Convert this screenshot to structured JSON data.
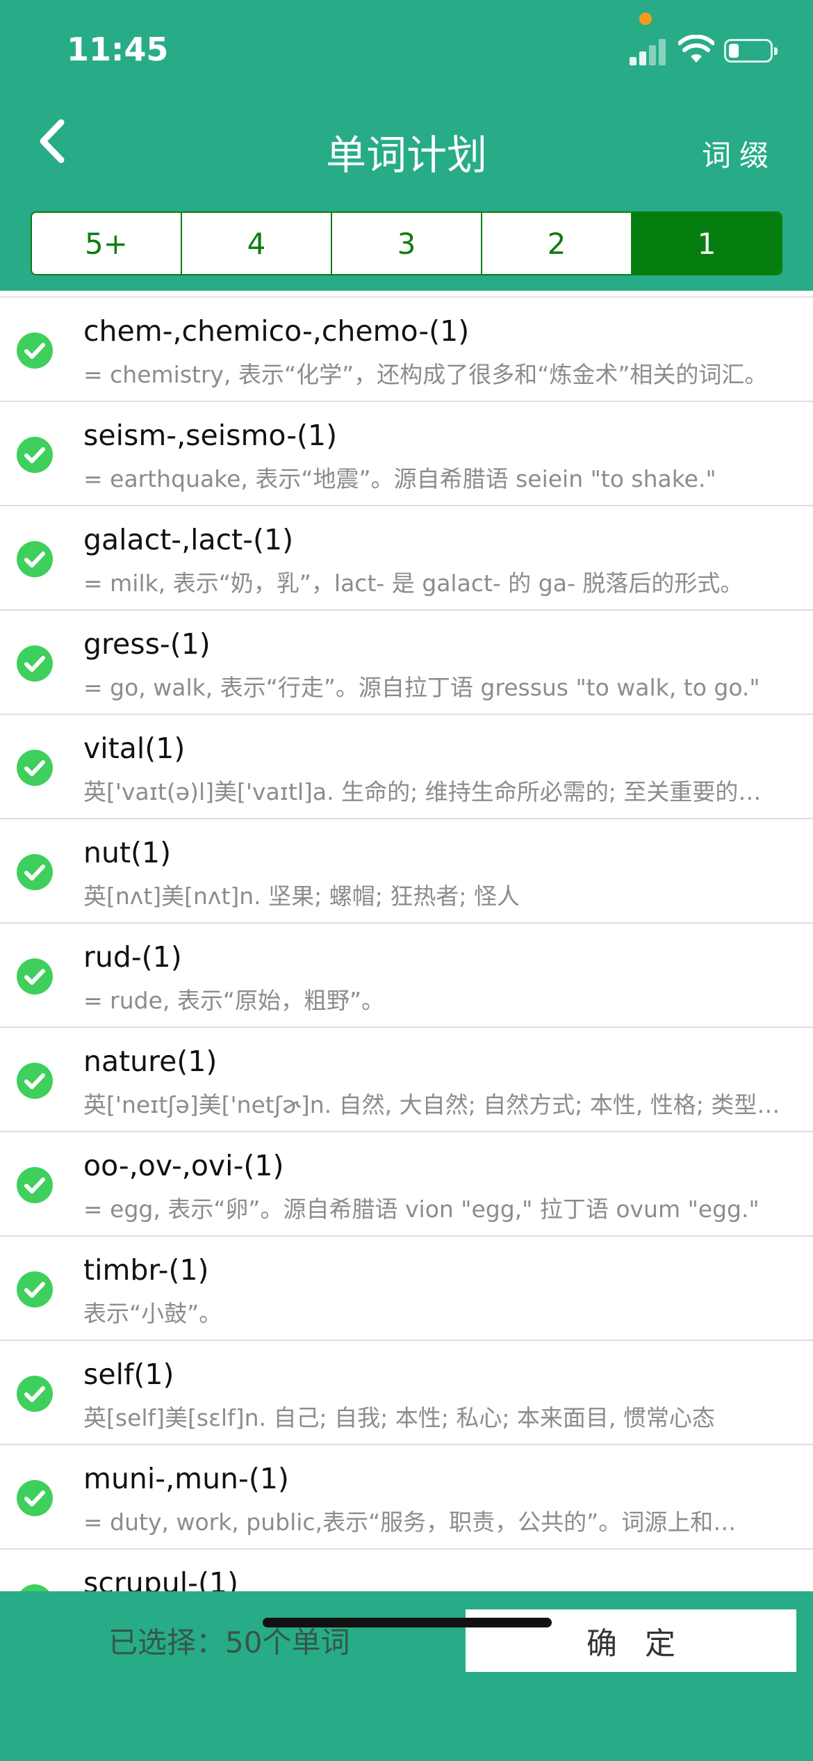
{
  "status_bar": {
    "time": "11:45"
  },
  "nav": {
    "title": "单词计划",
    "right_label": "词缀",
    "back_icon": "chevron-left-icon"
  },
  "segments": [
    {
      "label": "5+",
      "active": false
    },
    {
      "label": "4",
      "active": false
    },
    {
      "label": "3",
      "active": false
    },
    {
      "label": "2",
      "active": false
    },
    {
      "label": "1",
      "active": true
    }
  ],
  "items": [
    {
      "title": "chem-,chemico-,chemo-(1)",
      "subtitle": "= chemistry, 表示“化学”，还构成了很多和“炼金术”相关的词汇。"
    },
    {
      "title": "seism-,seismo-(1)",
      "subtitle": "= earthquake, 表示“地震”。源自希腊语 seiein \"to shake.\""
    },
    {
      "title": "galact-,lact-(1)",
      "subtitle": "= milk, 表示“奶，乳”，lact- 是 galact- 的 ga- 脱落后的形式。"
    },
    {
      "title": "gress-(1)",
      "subtitle": "= go, walk, 表示“行走”。源自拉丁语 gressus \"to walk, to go.\""
    },
    {
      "title": "vital(1)",
      "subtitle": "英['vaɪt(ə)l]美['vaɪtl]a. 生命的; 维持生命所必需的; 至关重要的…"
    },
    {
      "title": "nut(1)",
      "subtitle": "英[nʌt]美[nʌt]n. 坚果; 螺帽; 狂热者; 怪人"
    },
    {
      "title": "rud-(1)",
      "subtitle": "= rude, 表示“原始，粗野”。"
    },
    {
      "title": "nature(1)",
      "subtitle": "英['neɪtʃə]美['netʃɚ]n. 自然, 大自然; 自然方式; 本性, 性格; 类型…"
    },
    {
      "title": "oo-,ov-,ovi-(1)",
      "subtitle": "= egg, 表示“卵”。源自希腊语 vion \"egg,\" 拉丁语 ovum \"egg.\""
    },
    {
      "title": "timbr-(1)",
      "subtitle": "表示“小鼓”。"
    },
    {
      "title": "self(1)",
      "subtitle": "英[self]美[sɛlf]n. 自己; 自我; 本性; 私心; 本来面目, 惯常心态"
    },
    {
      "title": "muni-,mun-(1)",
      "subtitle": "= duty, work, public,表示“服务，职责，公共的”。词源上和…"
    },
    {
      "title": "scrupul-(1)",
      "subtitle": ""
    }
  ],
  "bottom": {
    "selected_text": "已选择：50个单词",
    "confirm_label": "确定"
  },
  "colors": {
    "header": "#27ac87",
    "segment": "#0d7d12",
    "check": "#3fcf5c"
  }
}
